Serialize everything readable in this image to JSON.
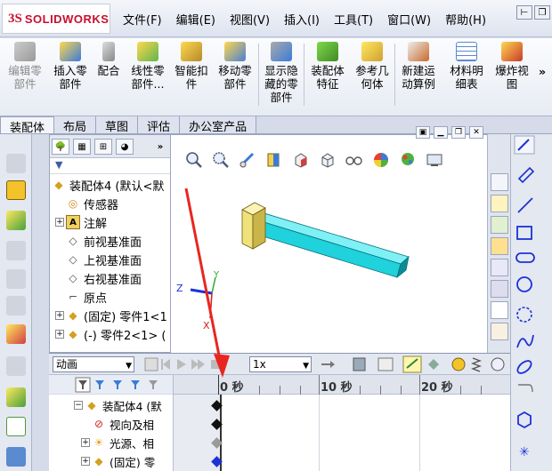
{
  "app": {
    "logo_prefix": "3S",
    "logo_name": "SOLIDWORKS"
  },
  "menu": [
    "文件(F)",
    "编辑(E)",
    "视图(V)",
    "插入(I)",
    "工具(T)",
    "窗口(W)",
    "帮助(H)"
  ],
  "ribbon": {
    "edit_component": "编辑零\n部件",
    "insert_component": "插入零\n部件",
    "mate": "配合",
    "linear_pattern": "线性零\n部件...",
    "smart_fastener": "智能扣\n件",
    "move_component": "移动零\n部件",
    "show_hidden": "显示隐\n藏的零\n部件",
    "assembly_feature": "装配体\n特征",
    "reference_geometry": "参考几\n何体",
    "new_motion_study": "新建运\n动算例",
    "bom": "材料明\n细表",
    "exploded_view": "爆炸视\n图",
    "more": "»"
  },
  "command_tabs": [
    "装配体",
    "布局",
    "草图",
    "评估",
    "办公室产品"
  ],
  "feature_tree": {
    "items": [
      {
        "label": "装配体4 (默认<默",
        "icon": "assembly-icon"
      },
      {
        "label": "传感器",
        "icon": "sensor-icon"
      },
      {
        "label": "注解",
        "icon": "annotation-icon"
      },
      {
        "label": "前视基准面",
        "icon": "plane-icon"
      },
      {
        "label": "上视基准面",
        "icon": "plane-icon"
      },
      {
        "label": "右视基准面",
        "icon": "plane-icon"
      },
      {
        "label": "原点",
        "icon": "origin-icon"
      },
      {
        "label": "(固定) 零件1<1",
        "icon": "part-icon"
      },
      {
        "label": "(-) 零件2<1> (",
        "icon": "part-icon"
      }
    ]
  },
  "motion": {
    "study_type": "动画",
    "speed": "1x",
    "time_labels": [
      "0 秒",
      "10 秒",
      "20 秒"
    ],
    "tree": [
      {
        "label": "装配体4 (默",
        "icon": "assembly-icon"
      },
      {
        "label": "视向及相",
        "icon": "camera-view-icon"
      },
      {
        "label": "光源、相",
        "icon": "lights-icon"
      },
      {
        "label": "(固定) 零",
        "icon": "part-icon"
      }
    ]
  },
  "triad": {
    "x": "X",
    "y": "Y",
    "z": "Z"
  },
  "colors": {
    "shaft": "#1fd2dc",
    "shaft_dark": "#0a8c96",
    "head": "#f0e27a",
    "arrow": "#e8261f",
    "logo": "#c8102e",
    "key_black": "#111111",
    "key_gray": "#9a9a9a",
    "key_blue": "#1a33d6"
  }
}
